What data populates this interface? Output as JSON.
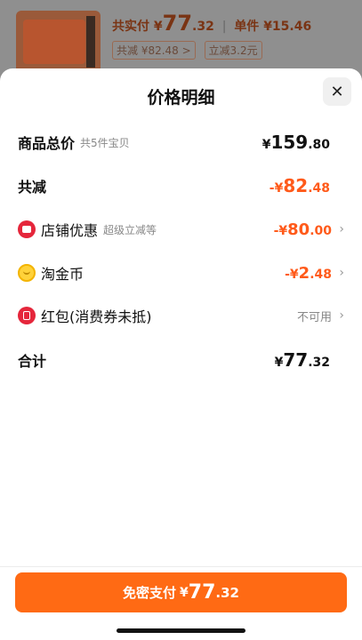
{
  "background": {
    "pay_label": "共实付",
    "pay_currency": "¥",
    "pay_int": "77",
    "pay_dec": ".32",
    "unit_label": "单件",
    "unit_price": "¥15.46",
    "reduce_label": "共减 ¥82.48 >",
    "instant_label": "立减3.2元"
  },
  "sheet": {
    "title": "价格明细",
    "close_icon": "close-icon"
  },
  "rows": {
    "total": {
      "label": "商品总价",
      "sub": "共5件宝贝",
      "currency": "¥",
      "int": "159",
      "dec": ".80"
    },
    "reduce": {
      "label": "共减",
      "currency": "-¥",
      "int": "82",
      "dec": ".48"
    },
    "shop": {
      "label": "店铺优惠",
      "sub": "超级立减等",
      "currency": "-¥",
      "int": "80",
      "dec": ".00",
      "icon": "shop-icon"
    },
    "coin": {
      "label": "淘金币",
      "currency": "-¥",
      "int": "2",
      "dec": ".48",
      "icon": "coin-icon"
    },
    "redpack": {
      "label": "红包(消费券未抵)",
      "status": "不可用",
      "icon": "red-packet-icon"
    },
    "sum": {
      "label": "合计",
      "currency": "¥",
      "int": "77",
      "dec": ".32"
    }
  },
  "footer": {
    "pay_label": "免密支付",
    "currency": "¥",
    "int": "77",
    "dec": ".32",
    "accent": "#ff6a14"
  }
}
